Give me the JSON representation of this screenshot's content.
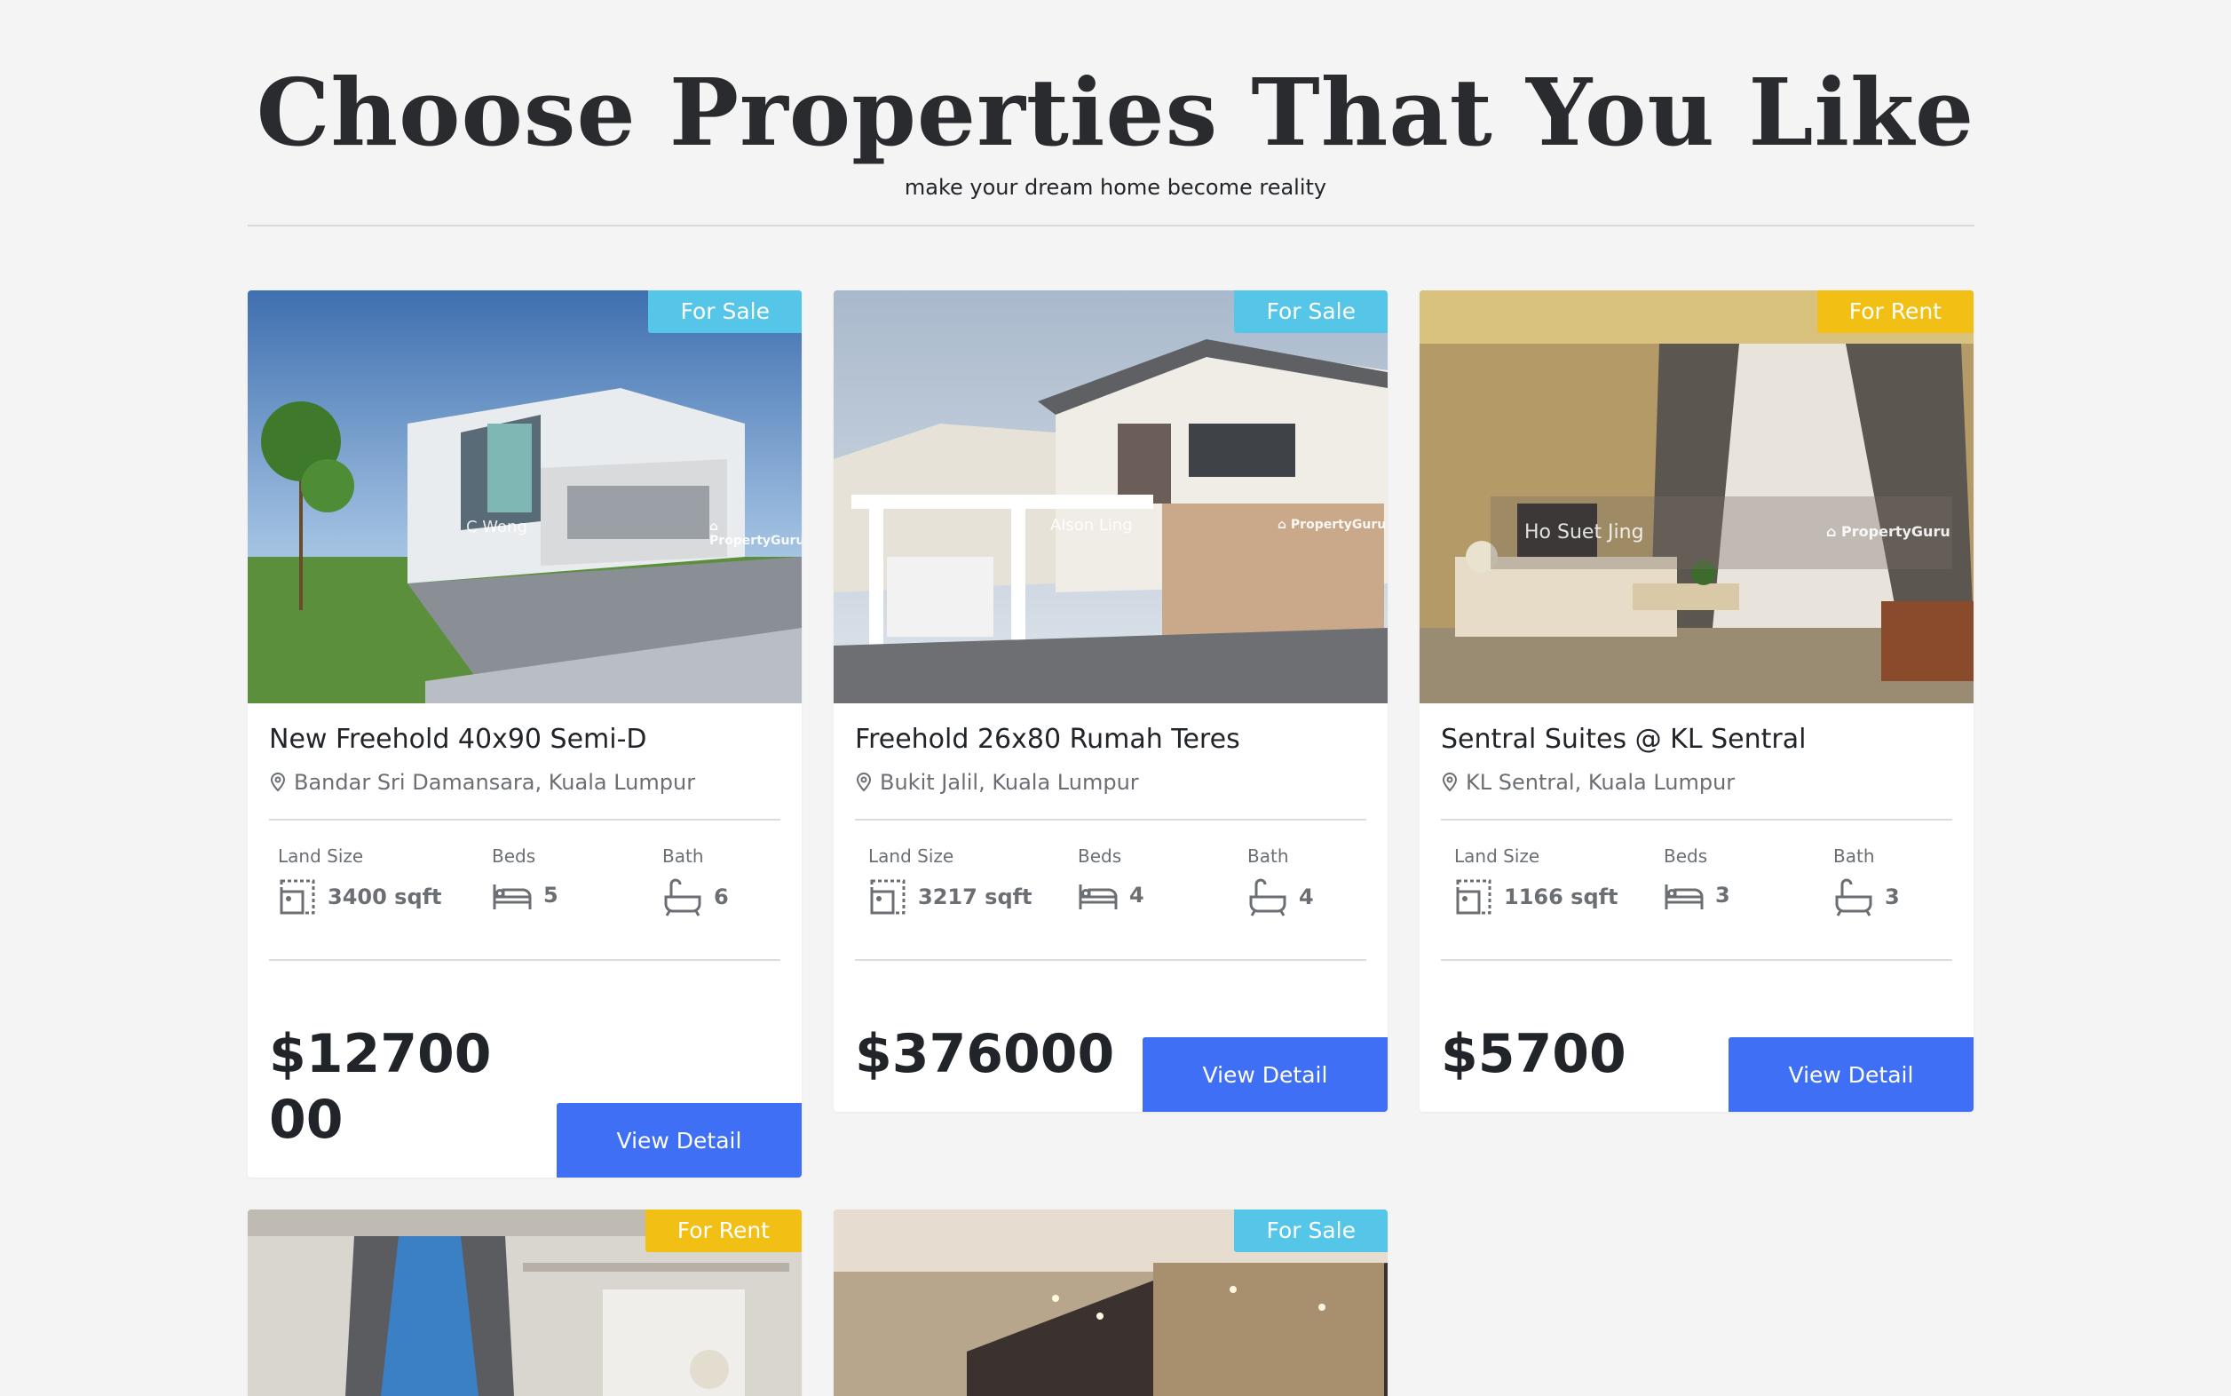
{
  "header": {
    "title": "Choose Properties That You Like",
    "subtitle": "make your dream home become reality"
  },
  "labels": {
    "land_size": "Land Size",
    "beds": "Beds",
    "bath": "Bath",
    "view_detail": "View Detail"
  },
  "colors": {
    "sale_badge": "#56c6e8",
    "rent_badge": "#f2bf14",
    "button": "#3e6ff4"
  },
  "watermark_brand": "PropertyGuru",
  "listings": [
    {
      "badge": "For Sale",
      "title": "New Freehold 40x90 Semi-D",
      "location": "Bandar Sri Damansara, Kuala Lumpur",
      "land_size": "3400 sqft",
      "beds": "5",
      "bath": "6",
      "price": "$1270000",
      "watermark": "C Wong"
    },
    {
      "badge": "For Sale",
      "title": "Freehold 26x80 Rumah Teres",
      "location": "Bukit Jalil, Kuala Lumpur",
      "land_size": "3217 sqft",
      "beds": "4",
      "bath": "4",
      "price": "$376000",
      "watermark": "Alson Ling"
    },
    {
      "badge": "For Rent",
      "title": "Sentral Suites @ KL Sentral",
      "location": "KL Sentral, Kuala Lumpur",
      "land_size": "1166 sqft",
      "beds": "3",
      "bath": "3",
      "price": "$5700",
      "watermark": "Ho Suet Jing"
    },
    {
      "badge": "For Rent"
    },
    {
      "badge": "For Sale"
    }
  ]
}
